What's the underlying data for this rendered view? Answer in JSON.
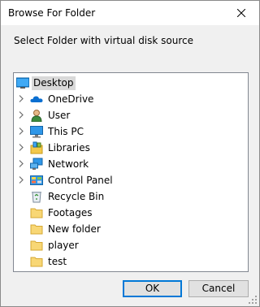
{
  "window": {
    "title": "Browse For Folder"
  },
  "dialog": {
    "prompt": "Select Folder with virtual disk source"
  },
  "tree": {
    "items": [
      {
        "label": "Desktop",
        "icon": "desktop-icon",
        "expandable": false,
        "selected": true
      },
      {
        "label": "OneDrive",
        "icon": "onedrive-cloud-icon",
        "expandable": true
      },
      {
        "label": "User",
        "icon": "user-icon",
        "expandable": true
      },
      {
        "label": "This PC",
        "icon": "computer-icon",
        "expandable": true
      },
      {
        "label": "Libraries",
        "icon": "libraries-icon",
        "expandable": true
      },
      {
        "label": "Network",
        "icon": "network-icon",
        "expandable": true
      },
      {
        "label": "Control Panel",
        "icon": "control-panel-icon",
        "expandable": true
      },
      {
        "label": "Recycle Bin",
        "icon": "recycle-bin-icon",
        "expandable": false
      },
      {
        "label": "Footages",
        "icon": "folder-icon",
        "expandable": false
      },
      {
        "label": "New folder",
        "icon": "folder-icon",
        "expandable": false
      },
      {
        "label": "player",
        "icon": "folder-icon",
        "expandable": false
      },
      {
        "label": "test",
        "icon": "folder-icon",
        "expandable": false
      }
    ]
  },
  "buttons": {
    "ok": "OK",
    "cancel": "Cancel"
  },
  "colors": {
    "accent": "#0078d7",
    "selection": "#d9d9d9",
    "folder": "#f8d775"
  }
}
